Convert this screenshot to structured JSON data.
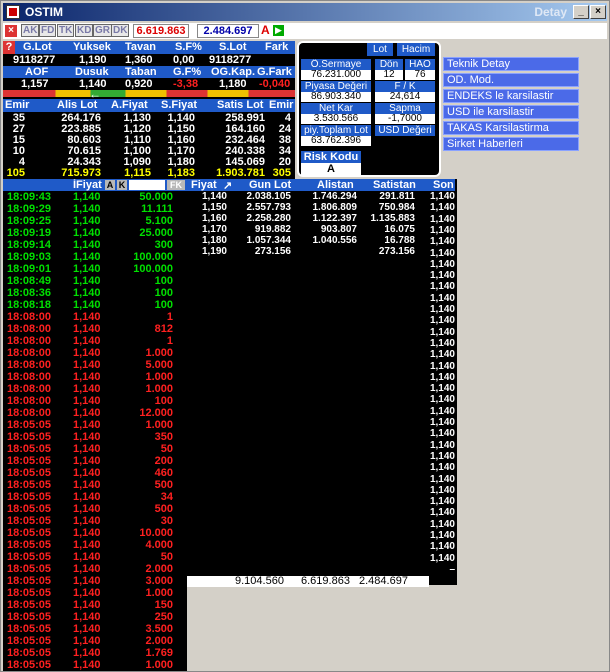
{
  "window": {
    "title": "OSTIM",
    "title_right": "Detay"
  },
  "toolbar": {
    "tags": [
      "AK",
      "FD",
      "TK",
      "KD",
      "GR",
      "DK"
    ],
    "value1": "6.619.863",
    "value2": "2.484.697",
    "a_label": "A"
  },
  "summary": {
    "row1_headers": [
      "G.Lot",
      "Yuksek",
      "Tavan",
      "S.F%",
      "S.Lot",
      "Fark"
    ],
    "row1_values": [
      "9118277",
      "1,190",
      "1,360",
      "0,00",
      "9118277",
      ""
    ],
    "row2_headers": [
      "AOF",
      "Dusuk",
      "Taban",
      "G.F%",
      "OG.Kap.",
      "G.Fark"
    ],
    "row2_values": [
      "1,157",
      "1,140",
      "0,920",
      "-3,38",
      "1,180",
      "-0,040"
    ]
  },
  "depth": {
    "headers": [
      "Emir",
      "Alis Lot",
      "A.Fiyat",
      "S.Fiyat",
      "Satis Lot",
      "Emir"
    ],
    "rows": [
      [
        "35",
        "264.176",
        "1,130",
        "1,140",
        "258.991",
        "4"
      ],
      [
        "27",
        "223.885",
        "1,120",
        "1,150",
        "164.160",
        "24"
      ],
      [
        "15",
        "80.603",
        "1,110",
        "1,160",
        "232.464",
        "38"
      ],
      [
        "10",
        "70.615",
        "1,100",
        "1,170",
        "240.338",
        "34"
      ],
      [
        "4",
        "24.343",
        "1,090",
        "1,180",
        "145.069",
        "20"
      ]
    ],
    "total": [
      "105",
      "715.973",
      "1,115",
      "1,183",
      "1.903.781",
      "305"
    ]
  },
  "stats": {
    "buttons": [
      "Lot",
      "Hacim"
    ],
    "items": [
      {
        "label": "Ö.Sermaye",
        "value": "76.231.000"
      },
      {
        "label": "Dön",
        "value": "12"
      },
      {
        "label": "HAO",
        "value": "76"
      },
      {
        "label": "Piyasa Değeri",
        "value": "86.903.340"
      },
      {
        "label": "F / K",
        "value": "24,614"
      },
      {
        "label": "Net Kar",
        "value": "3.530.566"
      },
      {
        "label": "Sapma",
        "value": "-1,7000"
      },
      {
        "label": "piy.Toplam Lot",
        "value": "63.762.396"
      },
      {
        "label": "USD Değeri",
        "value": ""
      }
    ],
    "risk_label": "Risk Kodu",
    "risk_value": "A"
  },
  "menu": [
    "Teknik Detay",
    "OD. Mod.",
    "ENDEKS le karsilastir",
    "USD ile karsilastir",
    "TAKAS Karsilastirma",
    "Sirket Haberleri"
  ],
  "trades": {
    "header_price": "İFiyat",
    "btn_a": "A",
    "btn_k": "K",
    "btn_fk": "FK",
    "rows": [
      [
        "18:09:43",
        "1,140",
        "50.000",
        "g"
      ],
      [
        "18:09:29",
        "1,140",
        "11.111",
        "g"
      ],
      [
        "18:09:25",
        "1,140",
        "5.100",
        "g"
      ],
      [
        "18:09:19",
        "1,140",
        "25.000",
        "g"
      ],
      [
        "18:09:14",
        "1,140",
        "300",
        "g"
      ],
      [
        "18:09:03",
        "1,140",
        "100.000",
        "g"
      ],
      [
        "18:09:01",
        "1,140",
        "100.000",
        "g"
      ],
      [
        "18:08:49",
        "1,140",
        "100",
        "g"
      ],
      [
        "18:08:36",
        "1,140",
        "100",
        "g"
      ],
      [
        "18:08:18",
        "1,140",
        "100",
        "g"
      ],
      [
        "18:08:00",
        "1,140",
        "1",
        "r"
      ],
      [
        "18:08:00",
        "1,140",
        "812",
        "r"
      ],
      [
        "18:08:00",
        "1,140",
        "1",
        "r"
      ],
      [
        "18:08:00",
        "1,140",
        "1.000",
        "r"
      ],
      [
        "18:08:00",
        "1,140",
        "5.000",
        "r"
      ],
      [
        "18:08:00",
        "1,140",
        "1.000",
        "r"
      ],
      [
        "18:08:00",
        "1,140",
        "1.000",
        "r"
      ],
      [
        "18:08:00",
        "1,140",
        "100",
        "r"
      ],
      [
        "18:08:00",
        "1,140",
        "12.000",
        "r"
      ],
      [
        "18:05:05",
        "1,140",
        "1.000",
        "r"
      ],
      [
        "18:05:05",
        "1,140",
        "350",
        "r"
      ],
      [
        "18:05:05",
        "1,140",
        "50",
        "r"
      ],
      [
        "18:05:05",
        "1,140",
        "200",
        "r"
      ],
      [
        "18:05:05",
        "1,140",
        "460",
        "r"
      ],
      [
        "18:05:05",
        "1,140",
        "500",
        "r"
      ],
      [
        "18:05:05",
        "1,140",
        "34",
        "r"
      ],
      [
        "18:05:05",
        "1,140",
        "500",
        "r"
      ],
      [
        "18:05:05",
        "1,140",
        "30",
        "r"
      ],
      [
        "18:05:05",
        "1,140",
        "10.000",
        "r"
      ],
      [
        "18:05:05",
        "1,140",
        "4.000",
        "r"
      ],
      [
        "18:05:05",
        "1,140",
        "50",
        "r"
      ],
      [
        "18:05:05",
        "1,140",
        "2.000",
        "r"
      ],
      [
        "18:05:05",
        "1,140",
        "3.000",
        "r"
      ],
      [
        "18:05:05",
        "1,140",
        "1.000",
        "r"
      ],
      [
        "18:05:05",
        "1,140",
        "150",
        "r"
      ],
      [
        "18:05:05",
        "1,140",
        "250",
        "r"
      ],
      [
        "18:05:05",
        "1,140",
        "3.500",
        "r"
      ],
      [
        "18:05:05",
        "1,140",
        "2.000",
        "r"
      ],
      [
        "18:05:05",
        "1,140",
        "1.769",
        "r"
      ],
      [
        "18:05:05",
        "1,140",
        "1.000",
        "r"
      ]
    ]
  },
  "price_dist": {
    "headers": [
      "Fiyat",
      "Gun Lot",
      "Alistan",
      "Satistan",
      "Son"
    ],
    "rows": [
      [
        "1,140",
        "2.038.105",
        "1.746.294",
        "291.811"
      ],
      [
        "1,150",
        "2.557.793",
        "1.806.809",
        "750.984"
      ],
      [
        "1,160",
        "2.258.280",
        "1.122.397",
        "1.135.883"
      ],
      [
        "1,170",
        "919.882",
        "903.807",
        "16.075"
      ],
      [
        "1,180",
        "1.057.344",
        "1.040.556",
        "16.788"
      ],
      [
        "1,190",
        "273.156",
        "",
        "273.156"
      ]
    ],
    "totals": [
      "9.104.560",
      "6.619.863",
      "2.484.697"
    ],
    "son_values": [
      "1,140",
      "1,140",
      "1,140",
      "1,140",
      "1,140",
      "1,140",
      "1,140",
      "1,140",
      "1,140",
      "1,140",
      "1,140",
      "1,140",
      "1,140",
      "1,140",
      "1,140",
      "1,140",
      "1,140",
      "1,140",
      "1,140",
      "1,140",
      "1,140",
      "1,140",
      "1,140",
      "1,140",
      "1,140",
      "1,140",
      "1,140",
      "1,140",
      "1,140",
      "1,140",
      "1,140",
      "1,140",
      "1,140",
      "–"
    ]
  },
  "colors": {
    "header_blue": "#1f5ac8",
    "green": "#00e000",
    "red": "#ff2020",
    "yellow": "#ffff00",
    "menu_blue": "#4b6ae8"
  }
}
